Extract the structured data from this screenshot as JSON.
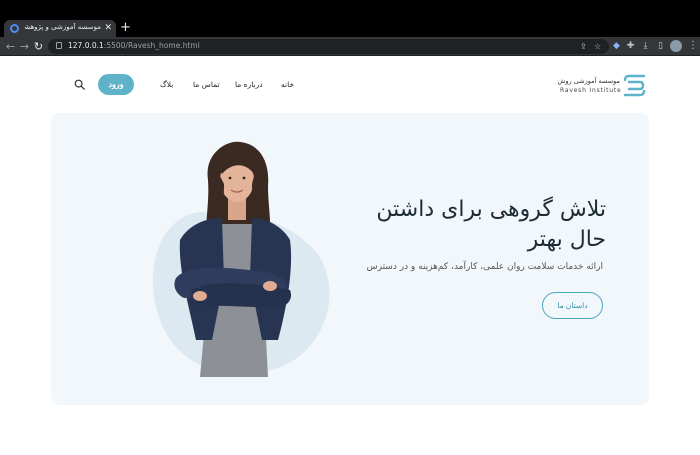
{
  "browser": {
    "tab": {
      "title": "موسسه آموزشی و پژوهشی روش",
      "close_glyph": "✕"
    },
    "new_tab_glyph": "+",
    "url": {
      "host": "127.0.0.1",
      "rest": ":5500/Ravesh_home.html"
    },
    "icons": [
      "back-icon",
      "forward-icon",
      "reload-icon",
      "lock-icon",
      "share-icon",
      "bookmark-star-icon",
      "extension-icon",
      "puzzle-icon",
      "sidebar-icon",
      "download-icon",
      "profile-avatar",
      "menu-icon"
    ]
  },
  "header": {
    "logo": {
      "name_fa": "موسسه آموزشی روش",
      "name_en": "Ravesh Institute"
    },
    "nav": [
      "خانه",
      "درباره ما",
      "تماس ما",
      "بلاگ"
    ],
    "login_label": "ورود"
  },
  "hero": {
    "title": "تلاش گروهی برای داشتن حال بهتر",
    "subtitle": "ارائه خدمات سلامت روان علمی، کارآمد، کم‌هزینه و در دسترس",
    "cta_label": "داستان ما"
  },
  "colors": {
    "accent": "#5fb3c9",
    "accent_dark": "#2f8ea9",
    "hero_bg": "#f2f7fb",
    "blob": "#dde9f0"
  }
}
